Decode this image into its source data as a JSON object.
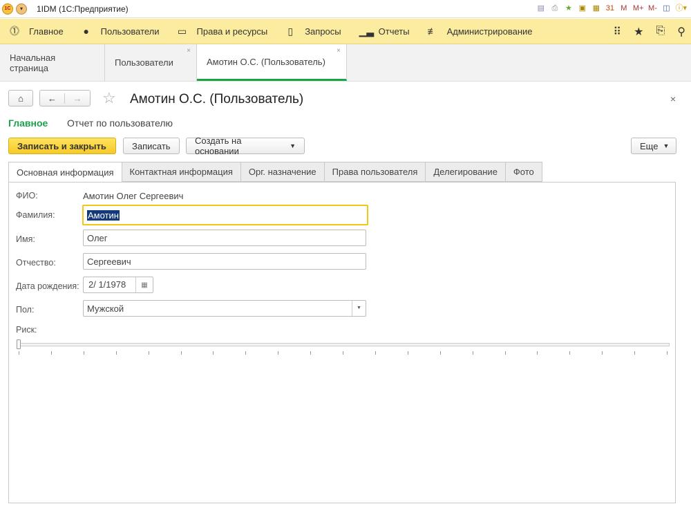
{
  "titlebar": {
    "app_title": "1IDM  (1С:Предприятие)",
    "logo_text": "1С",
    "right_icons": [
      "save-icon",
      "print-icon",
      "add-favorite-icon",
      "bookmark-icon",
      "calculator-icon",
      "calendar-icon",
      "M",
      "M+",
      "M-",
      "panel-icon",
      "info-icon"
    ]
  },
  "sections": [
    {
      "label": "Главное",
      "icon": "home-badge-icon",
      "glyph": "①"
    },
    {
      "label": "Пользователи",
      "icon": "user-icon",
      "glyph": "👤"
    },
    {
      "label": "Права и ресурсы",
      "icon": "folder-icon",
      "glyph": "🗀"
    },
    {
      "label": "Запросы",
      "icon": "document-icon",
      "glyph": "🗎"
    },
    {
      "label": "Отчеты",
      "icon": "bar-chart-icon",
      "glyph": "📊"
    },
    {
      "label": "Администрирование",
      "icon": "settings-sliders-icon",
      "glyph": "☰"
    }
  ],
  "open_tabs": [
    {
      "label": "Начальная страница"
    },
    {
      "label": "Пользователи",
      "close": "×"
    },
    {
      "label": "Амотин О.С. (Пользователь)",
      "close": "×"
    }
  ],
  "form": {
    "title": "Амотин О.С. (Пользователь)",
    "close": "×",
    "panels": {
      "main": "Главное",
      "report": "Отчет по пользователю"
    },
    "buttons": {
      "save_close": "Записать и закрыть",
      "save": "Записать",
      "create_based": "Создать на основании",
      "more": "Еще"
    },
    "tabs": [
      "Основная информация",
      "Контактная информация",
      "Орг. назначение",
      "Права пользователя",
      "Делегирование",
      "Фото"
    ],
    "fields": {
      "fio_label": "ФИО:",
      "fio_value": "Амотин Олег Сергеевич",
      "last_name_label": "Фамилия:",
      "last_name": "Амотин",
      "first_name_label": "Имя:",
      "first_name": "Олег",
      "middle_name_label": "Отчество:",
      "middle_name": "Сергеевич",
      "birth_label": "Дата рождения:",
      "birth_date": "2/ 1/1978",
      "gender_label": "Пол:",
      "gender": "Мужской",
      "risk_label": "Риск:",
      "risk_value": 0,
      "risk_ticks": 21
    }
  },
  "colors": {
    "accent_green": "#1aa34a",
    "section_bar": "#fbec9f",
    "primary_button": "#f6c92a",
    "focus": "#f5c518"
  }
}
